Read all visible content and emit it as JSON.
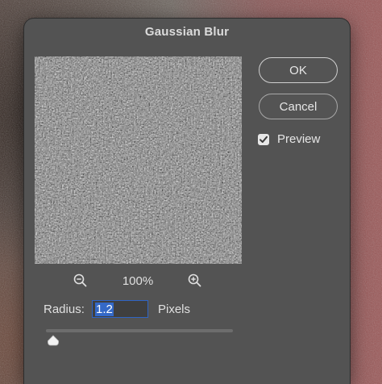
{
  "dialog": {
    "title": "Gaussian Blur"
  },
  "buttons": {
    "ok_label": "OK",
    "cancel_label": "Cancel"
  },
  "preview_option": {
    "label": "Preview",
    "checked": true
  },
  "zoom": {
    "level": "100%",
    "zoom_out_icon": "zoom-out-magnifier",
    "zoom_in_icon": "zoom-in-magnifier"
  },
  "radius": {
    "label": "Radius:",
    "value": "1.2",
    "unit": "Pixels"
  },
  "slider": {
    "fraction": 0.04
  },
  "colors": {
    "dialog_bg": "#535353",
    "selection_accent": "#3469c7",
    "text": "#e0e0e0"
  }
}
